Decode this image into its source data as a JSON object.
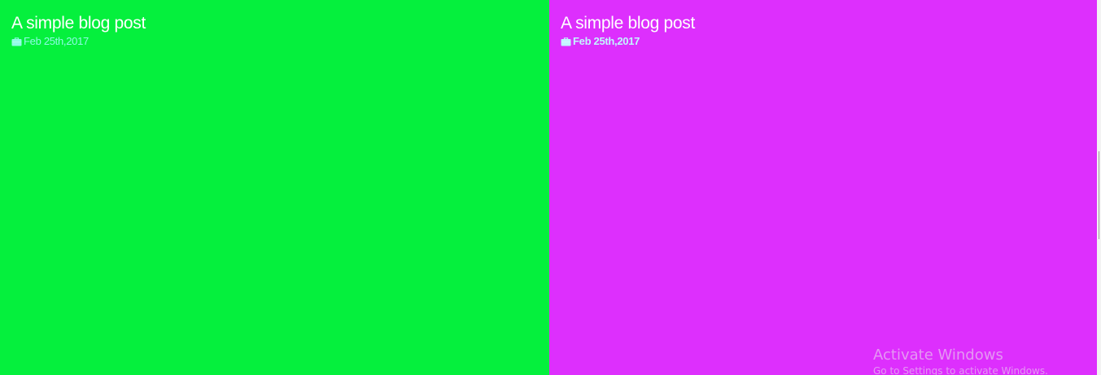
{
  "posts": [
    {
      "title": "A simple blog post",
      "date": "Feb 25th,2017",
      "icon": "briefcase-icon",
      "background": "#05f03d",
      "meta_color": "#8ffbe6"
    },
    {
      "title": "A simple blog post",
      "date": "Feb 25th,2017",
      "icon": "briefcase-icon",
      "background": "#dd2ffd",
      "meta_color": "#c2f5ff"
    }
  ],
  "watermark": {
    "title": "Activate Windows",
    "subtitle": "Go to Settings to activate Windows."
  }
}
